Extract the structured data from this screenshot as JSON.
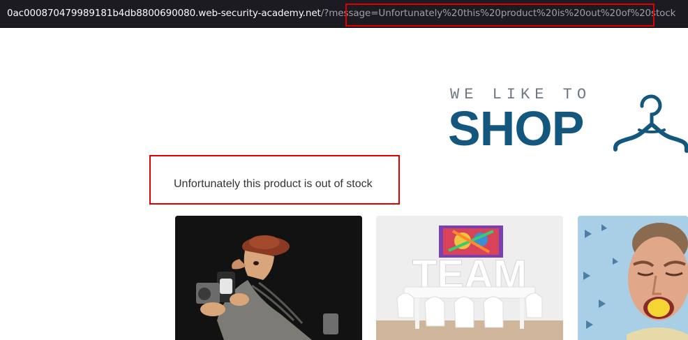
{
  "browser": {
    "url_host": "0ac000870479989181b4db8800690080.web-security-academy.net",
    "url_path": "/?message=Unfortunately%20this%20product%20is%20out%20of%20stock"
  },
  "logo": {
    "tagline": "WE LIKE TO",
    "word": "SHOP",
    "icon": "hanger-icon"
  },
  "message": {
    "text": "Unfortunately this product is out of stock"
  },
  "products": [
    {
      "image": "photographer-figurine-image"
    },
    {
      "image": "team-meeting-room-image"
    },
    {
      "image": "man-eating-lemon-image"
    }
  ],
  "colors": {
    "highlight": "#e00000",
    "brand": "#13577e",
    "urlbar": "#1c1b22"
  }
}
